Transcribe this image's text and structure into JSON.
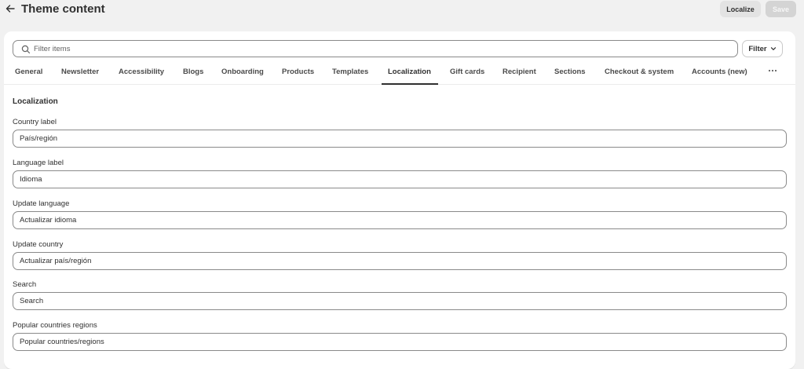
{
  "header": {
    "back_icon": "arrow-left-icon",
    "title": "Theme content",
    "localize_label": "Localize",
    "save_label": "Save"
  },
  "search": {
    "placeholder": "Filter items",
    "value": "",
    "filter_label": "Filter"
  },
  "tabs": [
    {
      "label": "General"
    },
    {
      "label": "Newsletter"
    },
    {
      "label": "Accessibility"
    },
    {
      "label": "Blogs"
    },
    {
      "label": "Onboarding"
    },
    {
      "label": "Products"
    },
    {
      "label": "Templates"
    },
    {
      "label": "Localization",
      "active": true
    },
    {
      "label": "Gift cards"
    },
    {
      "label": "Recipient"
    },
    {
      "label": "Sections"
    },
    {
      "label": "Checkout & system"
    },
    {
      "label": "Accounts (new)"
    }
  ],
  "section": {
    "heading": "Localization",
    "fields": [
      {
        "label": "Country label",
        "value": "País/región"
      },
      {
        "label": "Language label",
        "value": "Idioma"
      },
      {
        "label": "Update language",
        "value": "Actualizar idioma"
      },
      {
        "label": "Update country",
        "value": "Actualizar país/región"
      },
      {
        "label": "Search",
        "value": "Search"
      },
      {
        "label": "Popular countries regions",
        "value": "Popular countries/regions"
      }
    ]
  },
  "colors": {
    "background": "#f1f1f1",
    "card": "#ffffff",
    "text": "#303030",
    "border": "#8a8a8a"
  }
}
